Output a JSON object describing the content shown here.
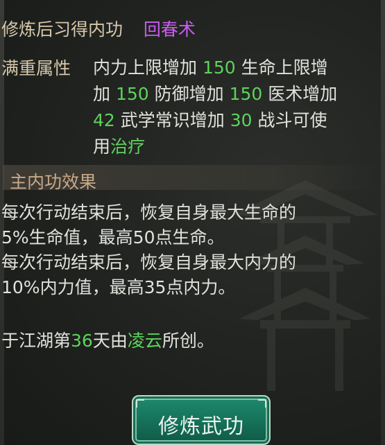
{
  "learned": {
    "label": "修炼后习得内功",
    "skill": "回春术"
  },
  "attributes": {
    "label": "满重属性",
    "line1": {
      "a": "内力上限增加 ",
      "a_val": "150",
      "b": " 生命上限增"
    },
    "line2": {
      "a": "加 ",
      "a_val": "150",
      "b": " 防御增加 ",
      "b_val": "150",
      "c": " 医术增加"
    },
    "line3": {
      "a_val": "42",
      "a": " 武学常识增加 ",
      "b_val": "30",
      "b": " 战斗可使"
    },
    "line4": {
      "a": "用",
      "a_val": "治疗"
    }
  },
  "main_effect": {
    "title": "主内功效果",
    "lines": [
      "每次行动结束后，恢复自身最大生命的",
      "5%生命值，最高50点生命。",
      "每次行动结束后，恢复自身最大内力的",
      "10%内力值，最高35点内力。"
    ]
  },
  "origin": {
    "prefix": "于江湖第",
    "day": "36",
    "mid": "天由",
    "creator": "凌云",
    "suffix": "所创。"
  },
  "button": {
    "label": "修炼武功"
  },
  "colors": {
    "accent_purple": "#c95cf0",
    "accent_green": "#5cd45a",
    "label_tan": "#d7c8aa",
    "button_teal": "#157058"
  }
}
